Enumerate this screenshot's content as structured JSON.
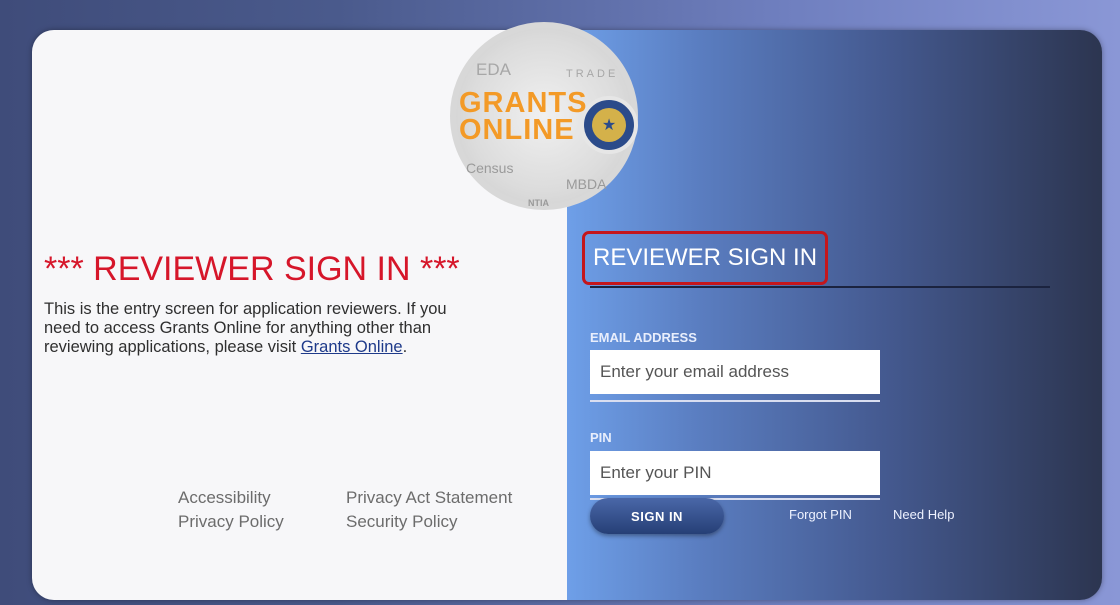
{
  "logo": {
    "eda": "EDA",
    "trade": "TRADE",
    "grants_line1": "GRANTS",
    "grants_line2": "ONLINE",
    "census": "Census",
    "mbda": "MBDA",
    "ntia": "NTIA"
  },
  "left": {
    "title": "*** REVIEWER SIGN IN ***",
    "description_text": "This is the entry screen for application reviewers. If you need to access Grants Online for anything other than reviewing applications, please visit ",
    "description_link": "Grants Online",
    "description_end": "."
  },
  "footer": {
    "accessibility": "Accessibility",
    "privacy_policy": "Privacy Policy",
    "privacy_act": "Privacy Act Statement",
    "security_policy": "Security Policy"
  },
  "form": {
    "title": "REVIEWER SIGN IN",
    "email_label": "EMAIL ADDRESS",
    "email_placeholder": "Enter your email address",
    "pin_label": "PIN",
    "pin_placeholder": "Enter your PIN",
    "signin_label": "SIGN IN",
    "forgot_pin": "Forgot PIN",
    "need_help": "Need Help"
  },
  "colors": {
    "title_red": "#d6162a",
    "highlight_box": "#c4161c",
    "logo_orange": "#f39a27"
  },
  "icons": {
    "emblem": "department-of-commerce-seal-icon"
  }
}
